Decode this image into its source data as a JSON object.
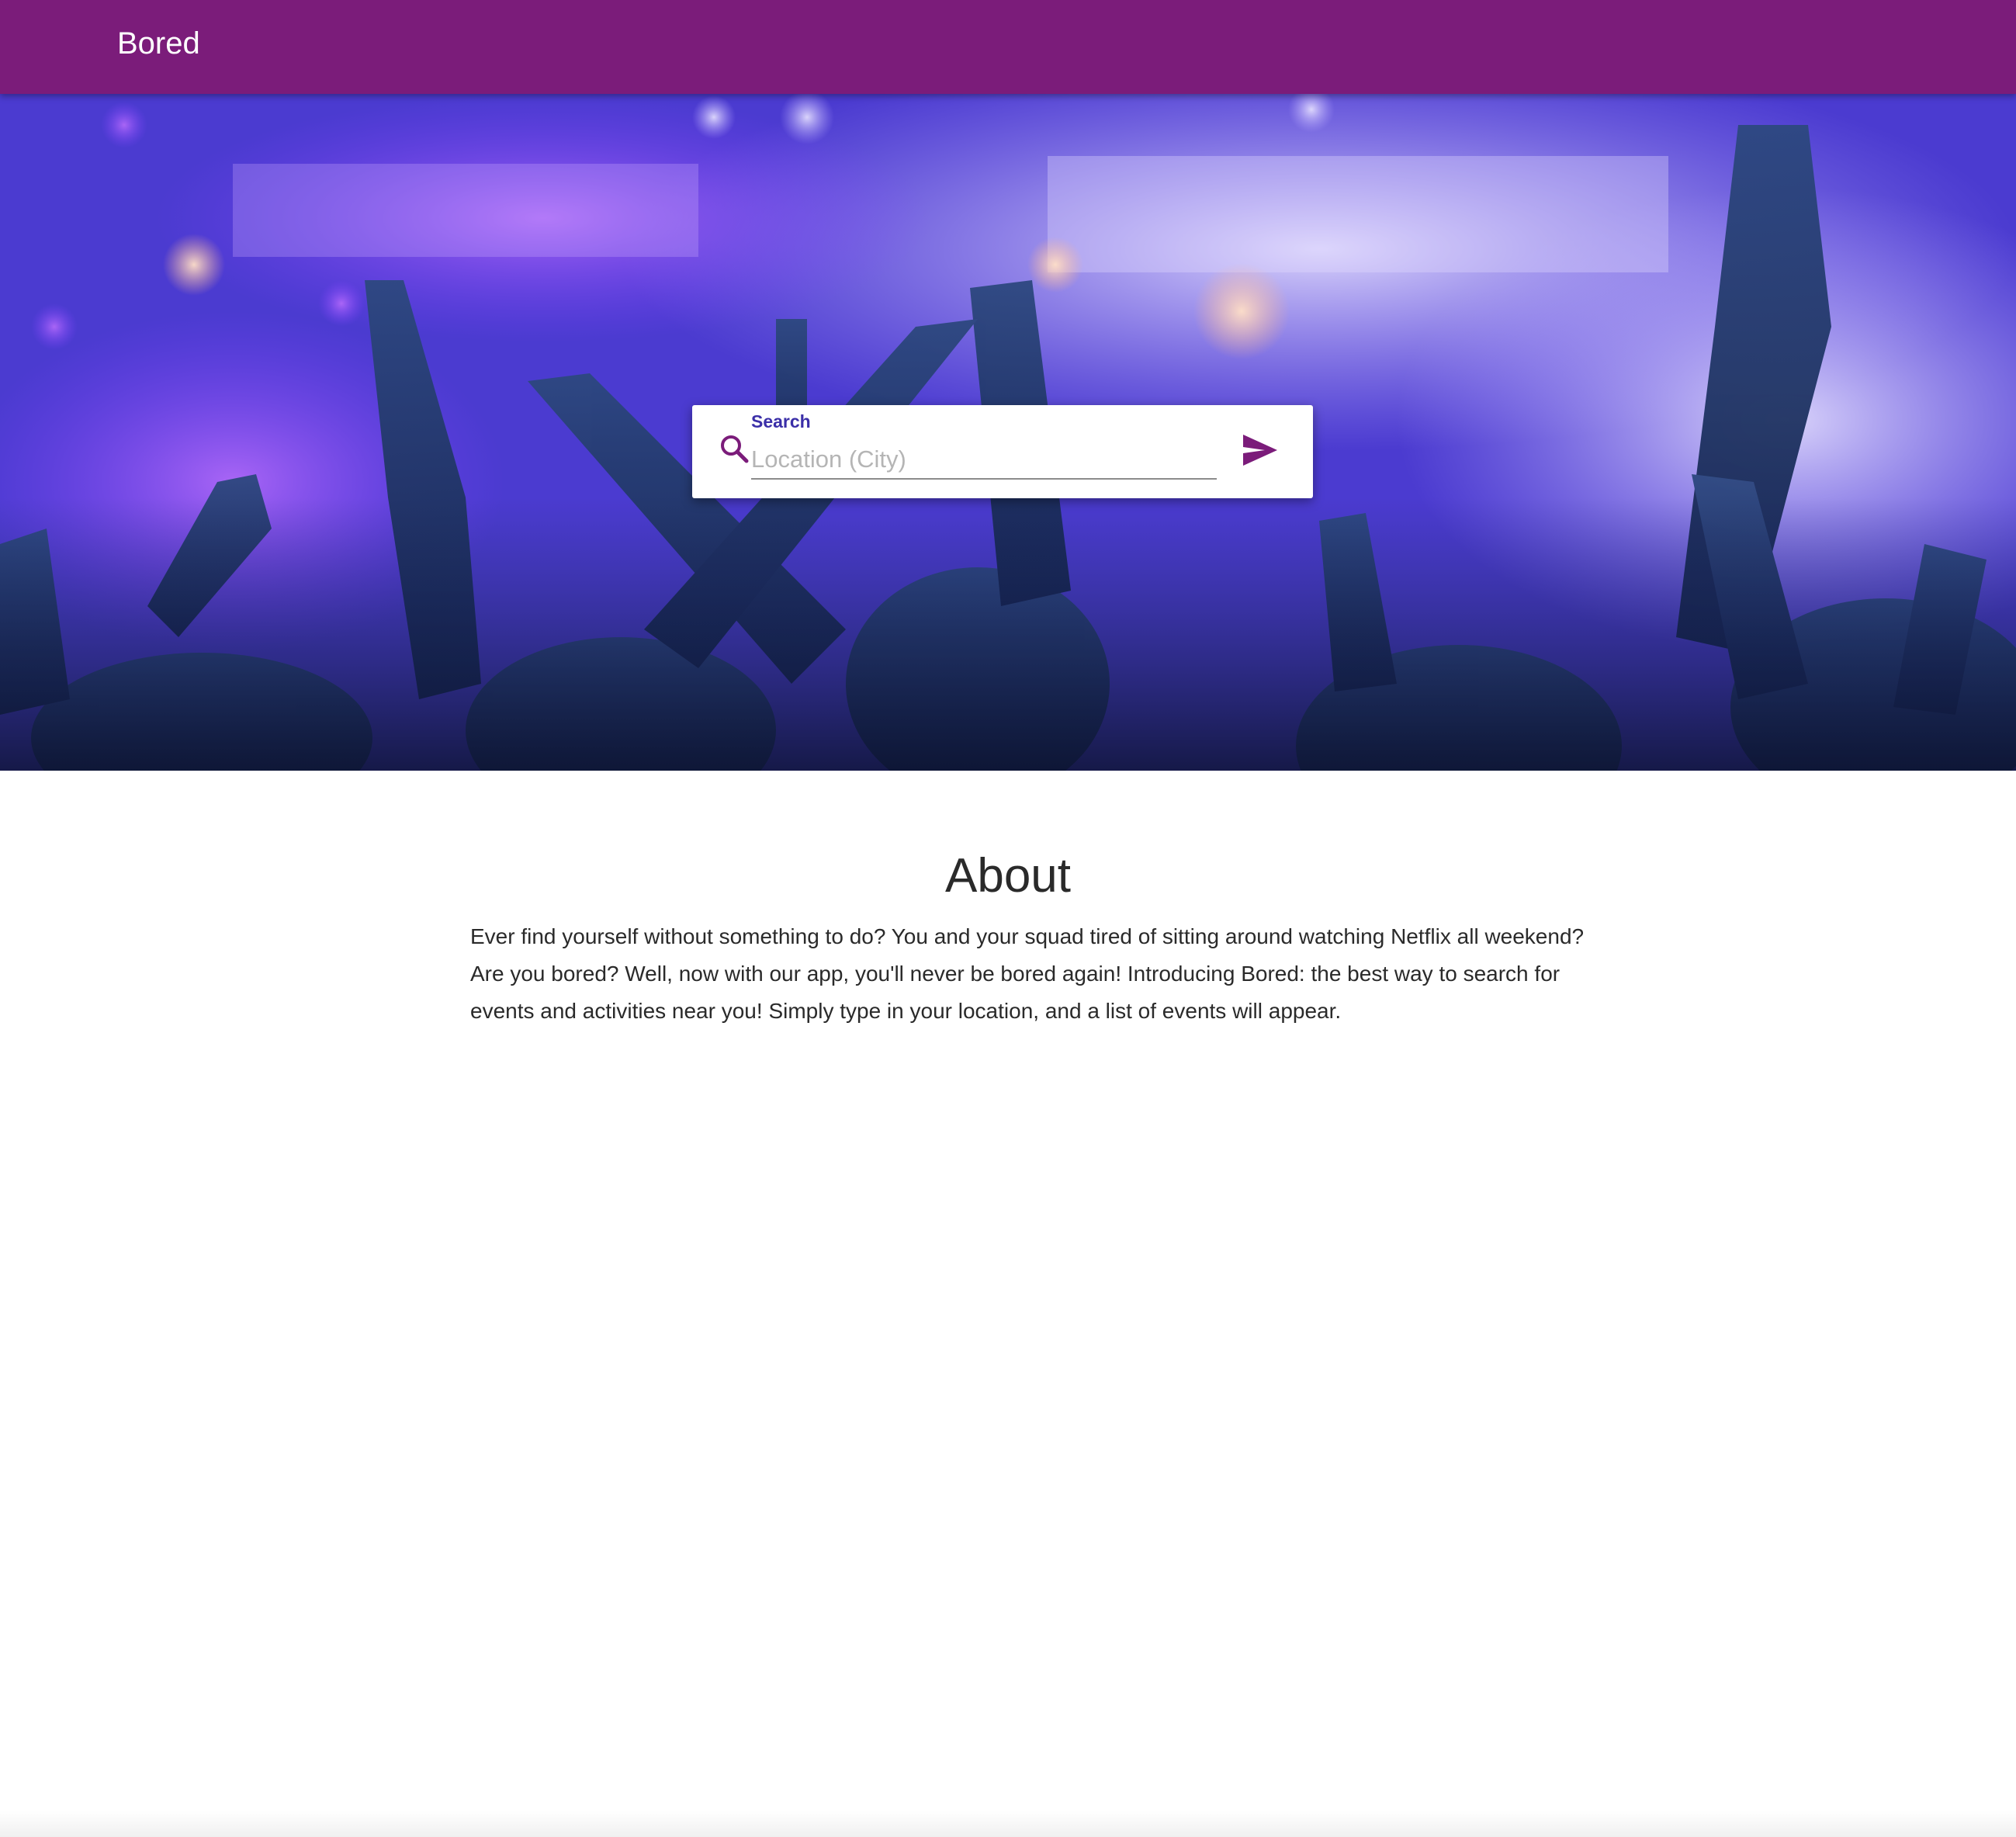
{
  "appbar": {
    "title": "Bored",
    "color": "#7b1c7a"
  },
  "hero": {
    "image": "concert-crowd-hands-raised"
  },
  "search": {
    "label": "Search",
    "placeholder": "Location (City)",
    "value": "",
    "icon": "search-icon",
    "submit_icon": "send-icon",
    "accent": "#7b1c7a",
    "label_color": "#3b2fa8"
  },
  "about": {
    "heading": "About",
    "body": "Ever find yourself without something to do? You and your squad tired of sitting around watching Netflix all weekend? Are you bored? Well, now with our app, you'll never be bored again! Introducing Bored: the best way to search for events and activities near you! Simply type in your location, and a list of events will appear."
  }
}
